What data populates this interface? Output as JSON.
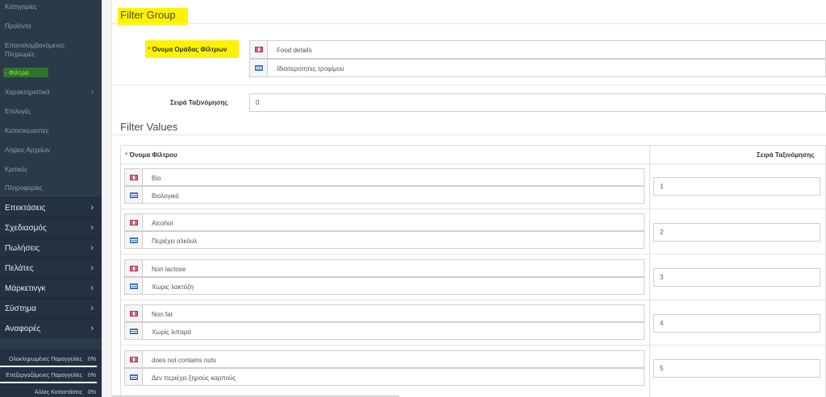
{
  "sidebar": {
    "sub_items": [
      {
        "label": "Κατηγορίες",
        "chevron": false,
        "active": false
      },
      {
        "label": "Προϊόντα",
        "chevron": false,
        "active": false
      },
      {
        "label": "Επαναλαμβανόμενες",
        "label2": "Πληρωμές",
        "chevron": false,
        "active": false
      },
      {
        "label": "- Φίλτρα",
        "chevron": false,
        "active": true
      },
      {
        "label": "Χαρακτηριστικά",
        "chevron": true,
        "active": false
      },
      {
        "label": "Επιλογές",
        "chevron": false,
        "active": false
      },
      {
        "label": "Κατασκευαστές",
        "chevron": false,
        "active": false
      },
      {
        "label": "Λήψεις Αρχείων",
        "chevron": false,
        "active": false
      },
      {
        "label": "Κριτικές",
        "chevron": false,
        "active": false
      },
      {
        "label": "Πληροφορίες",
        "chevron": false,
        "active": false
      }
    ],
    "main_items": [
      {
        "label": "Επεκτάσεις"
      },
      {
        "label": "Σχεδιασμός"
      },
      {
        "label": "Πωλήσεις"
      },
      {
        "label": "Πελάτες"
      },
      {
        "label": "Μάρκετινγκ"
      },
      {
        "label": "Σύστημα"
      },
      {
        "label": "Αναφορές"
      }
    ],
    "stats": [
      {
        "label": "Ολοκληρωμένες Παραγγελίες",
        "pct": "0%"
      },
      {
        "label": "Επεξεργαζόμενες Παραγγελίες",
        "pct": "0%"
      },
      {
        "label": "Άλλες Καταστάσεις",
        "pct": "0%"
      }
    ],
    "chevron": "›",
    "colors": {
      "bg": "#2b3a48",
      "active": "#a6e22e",
      "highlight": "#2f7d2a"
    }
  },
  "group": {
    "title": "Filter Group",
    "name_label": "Όνομα Ομάδας Φίλτρων",
    "required_mark": "*",
    "name_en": "Food details",
    "name_gr": "Ιδιαιτεροτητες τροφίμου",
    "sort_label": "Σειρά Ταξινόμησης",
    "sort_value": "0"
  },
  "values": {
    "title": "Filter Values",
    "col_name": "Όνομα Φίλτρου",
    "col_sort": "Σειρά Ταξινόμησης",
    "rows": [
      {
        "en": "Bio",
        "gr": "Βιολογικό",
        "sort": "1"
      },
      {
        "en": "Alcohol",
        "gr": "Περιέχει αλκόολ",
        "sort": "2"
      },
      {
        "en": "Non lactose",
        "gr": "Χωρις λακτόζη",
        "sort": "3"
      },
      {
        "en": "Non fat",
        "gr": "Χωρίς λιπαρά",
        "sort": "4"
      },
      {
        "en": "does not contains nuts",
        "gr": "Δεν περιέχει ξηρούς καρπούς",
        "sort": "5"
      }
    ]
  },
  "icons": {
    "uk": "uk-flag-icon",
    "gr": "greek-flag-icon"
  },
  "highlight_color": "#fff200"
}
